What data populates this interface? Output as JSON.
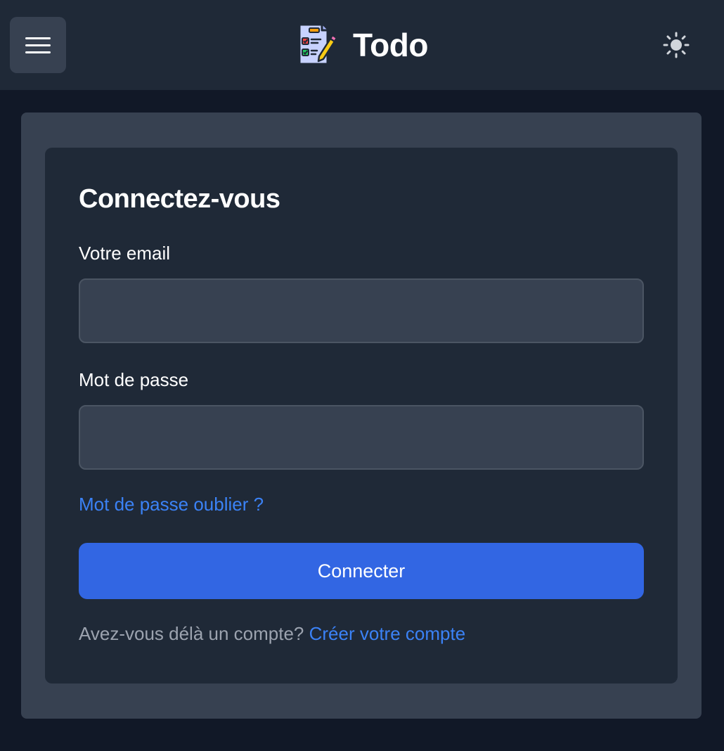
{
  "header": {
    "title": "Todo",
    "menu_icon": "hamburger-menu-icon",
    "logo_icon": "todo-checklist-logo-icon",
    "theme_icon": "sun-icon"
  },
  "login": {
    "title": "Connectez-vous",
    "email_label": "Votre email",
    "email_value": "",
    "email_placeholder": "",
    "password_label": "Mot de passe",
    "password_value": "",
    "password_placeholder": "",
    "forgot_link": "Mot de passe oublier ?",
    "submit_label": "Connecter",
    "signup_prompt": "Avez-vous délà un compte?",
    "signup_link": "Créer votre compte"
  },
  "colors": {
    "page_background": "#111827",
    "header_background": "#1f2937",
    "panel_background": "#374151",
    "card_background": "#1f2937",
    "input_background": "#374151",
    "primary_button": "#3266e3",
    "link": "#3b82f6",
    "muted_text": "#9ca3af"
  }
}
